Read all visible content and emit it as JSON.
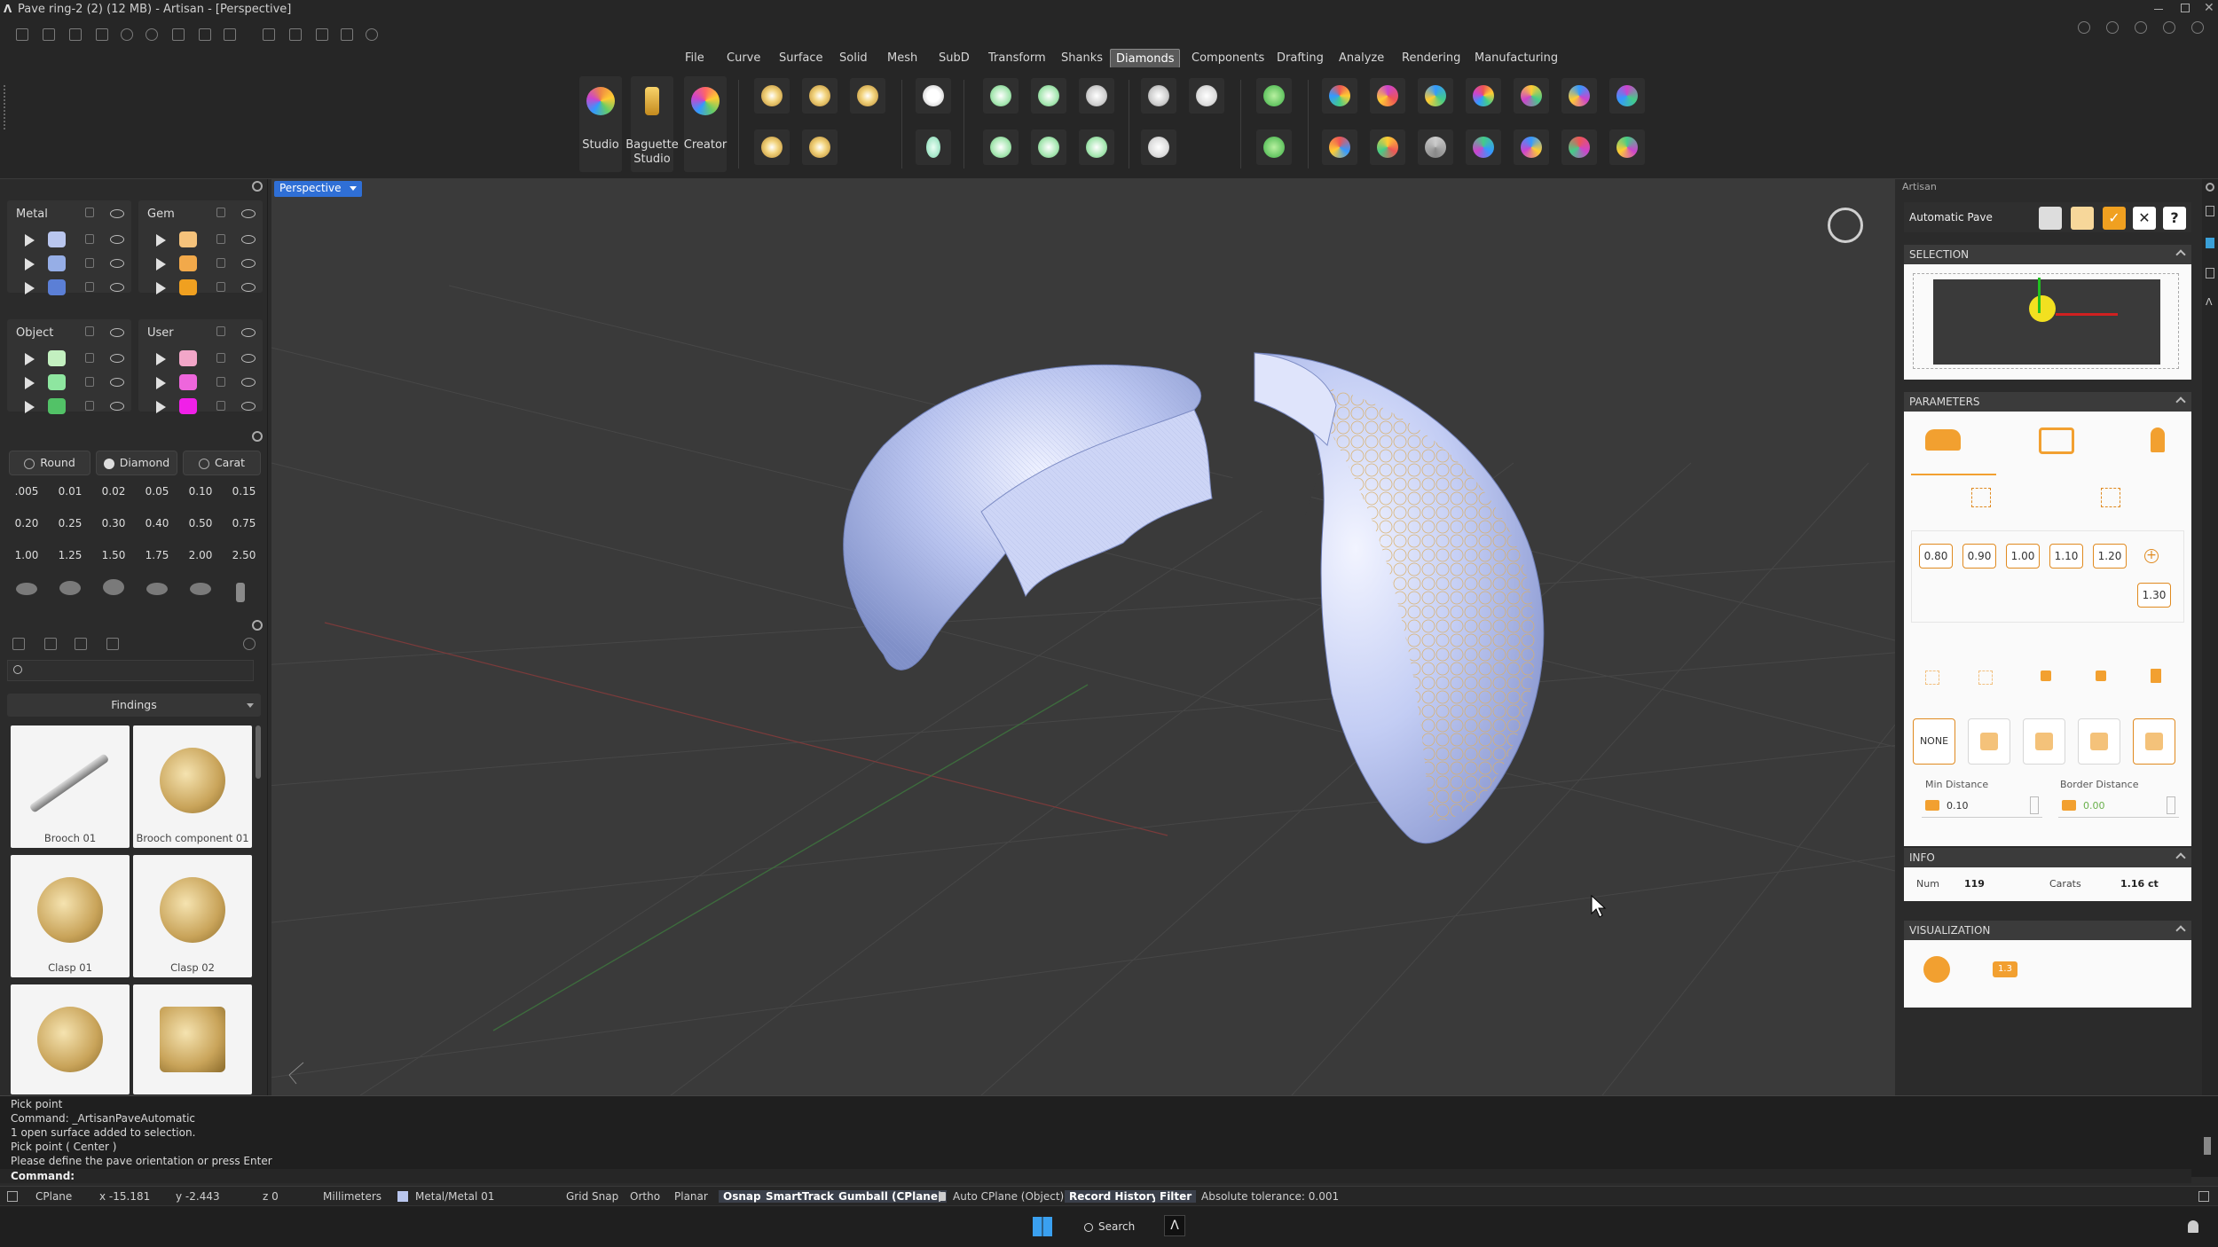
{
  "window": {
    "title": "Pave ring-2 (2) (12 MB) - Artisan - [Perspective]"
  },
  "menu": {
    "items": [
      "File",
      "Curve",
      "Surface",
      "Solid",
      "Mesh",
      "SubD",
      "Transform",
      "Shanks",
      "Diamonds",
      "Components",
      "Drafting",
      "Analyze",
      "Rendering",
      "Manufacturing"
    ],
    "active": "Diamonds"
  },
  "ribbon": {
    "studio": "Studio",
    "baguette_1": "Baguette",
    "baguette_2": "Studio",
    "creator": "Creator"
  },
  "layers": {
    "metal": {
      "title": "Metal",
      "colors": [
        "#b9c6ee",
        "#96aee6",
        "#5b7fd6"
      ]
    },
    "gem": {
      "title": "Gem",
      "colors": [
        "#f5c27b",
        "#f2a94a",
        "#f0a020"
      ]
    },
    "object": {
      "title": "Object",
      "colors": [
        "#c3f0c0",
        "#8ee6a0",
        "#52c267"
      ]
    },
    "user": {
      "title": "User",
      "colors": [
        "#f2a6c8",
        "#ee66dc",
        "#f020e8"
      ]
    }
  },
  "gems": {
    "shape_label": "Round",
    "type_label": "Diamond",
    "unit_label": "Carat",
    "carats": [
      ".005",
      "0.01",
      "0.02",
      "0.05",
      "0.10",
      "0.15",
      "0.20",
      "0.25",
      "0.30",
      "0.40",
      "0.50",
      "0.75",
      "1.00",
      "1.25",
      "1.50",
      "1.75",
      "2.00",
      "2.50"
    ]
  },
  "library": {
    "category": "Findings",
    "items": [
      "Brooch 01",
      "Brooch component 01",
      "Clasp 01",
      "Clasp 02"
    ]
  },
  "viewport": {
    "label": "Perspective"
  },
  "right_panel": {
    "title": "Artisan",
    "command": "Automatic Pave",
    "help_label": "?",
    "sections": {
      "selection": "SELECTION",
      "parameters": "PARAMETERS",
      "info": "INFO",
      "visualization": "VISUALIZATION"
    },
    "size_factors": [
      "0.80",
      "0.90",
      "1.00",
      "1.10",
      "1.20",
      "1.30"
    ],
    "none_label": "NONE",
    "min_distance_label": "Min Distance",
    "min_distance_value": "0.10",
    "border_distance_label": "Border Distance",
    "border_distance_value": "0.00",
    "info_num_label": "Num",
    "info_num_value": "119",
    "info_carats_label": "Carats",
    "info_carats_value": "1.16 ct",
    "vis_badge": "1.3"
  },
  "command_history": [
    "Pick point",
    "Command: _ArtisanPaveAutomatic",
    "1 open surface added to selection.",
    "Pick point ( Center )",
    "Please define the pave orientation or press Enter"
  ],
  "command_prompt": "Command:",
  "status": {
    "cplane": "CPlane",
    "x": "x -15.181",
    "y": "y -2.443",
    "z": "z 0",
    "units": "Millimeters",
    "layer": "Metal/Metal 01",
    "grid_snap": "Grid Snap",
    "ortho": "Ortho",
    "planar": "Planar",
    "osnap": "Osnap",
    "smarttrack": "SmartTrack",
    "gumball": "Gumball (CPlane)",
    "auto_cplane": "Auto CPlane (Object)",
    "record_history": "Record History",
    "filter": "Filter",
    "tolerance": "Absolute tolerance: 0.001"
  },
  "taskbar": {
    "search": "Search"
  }
}
